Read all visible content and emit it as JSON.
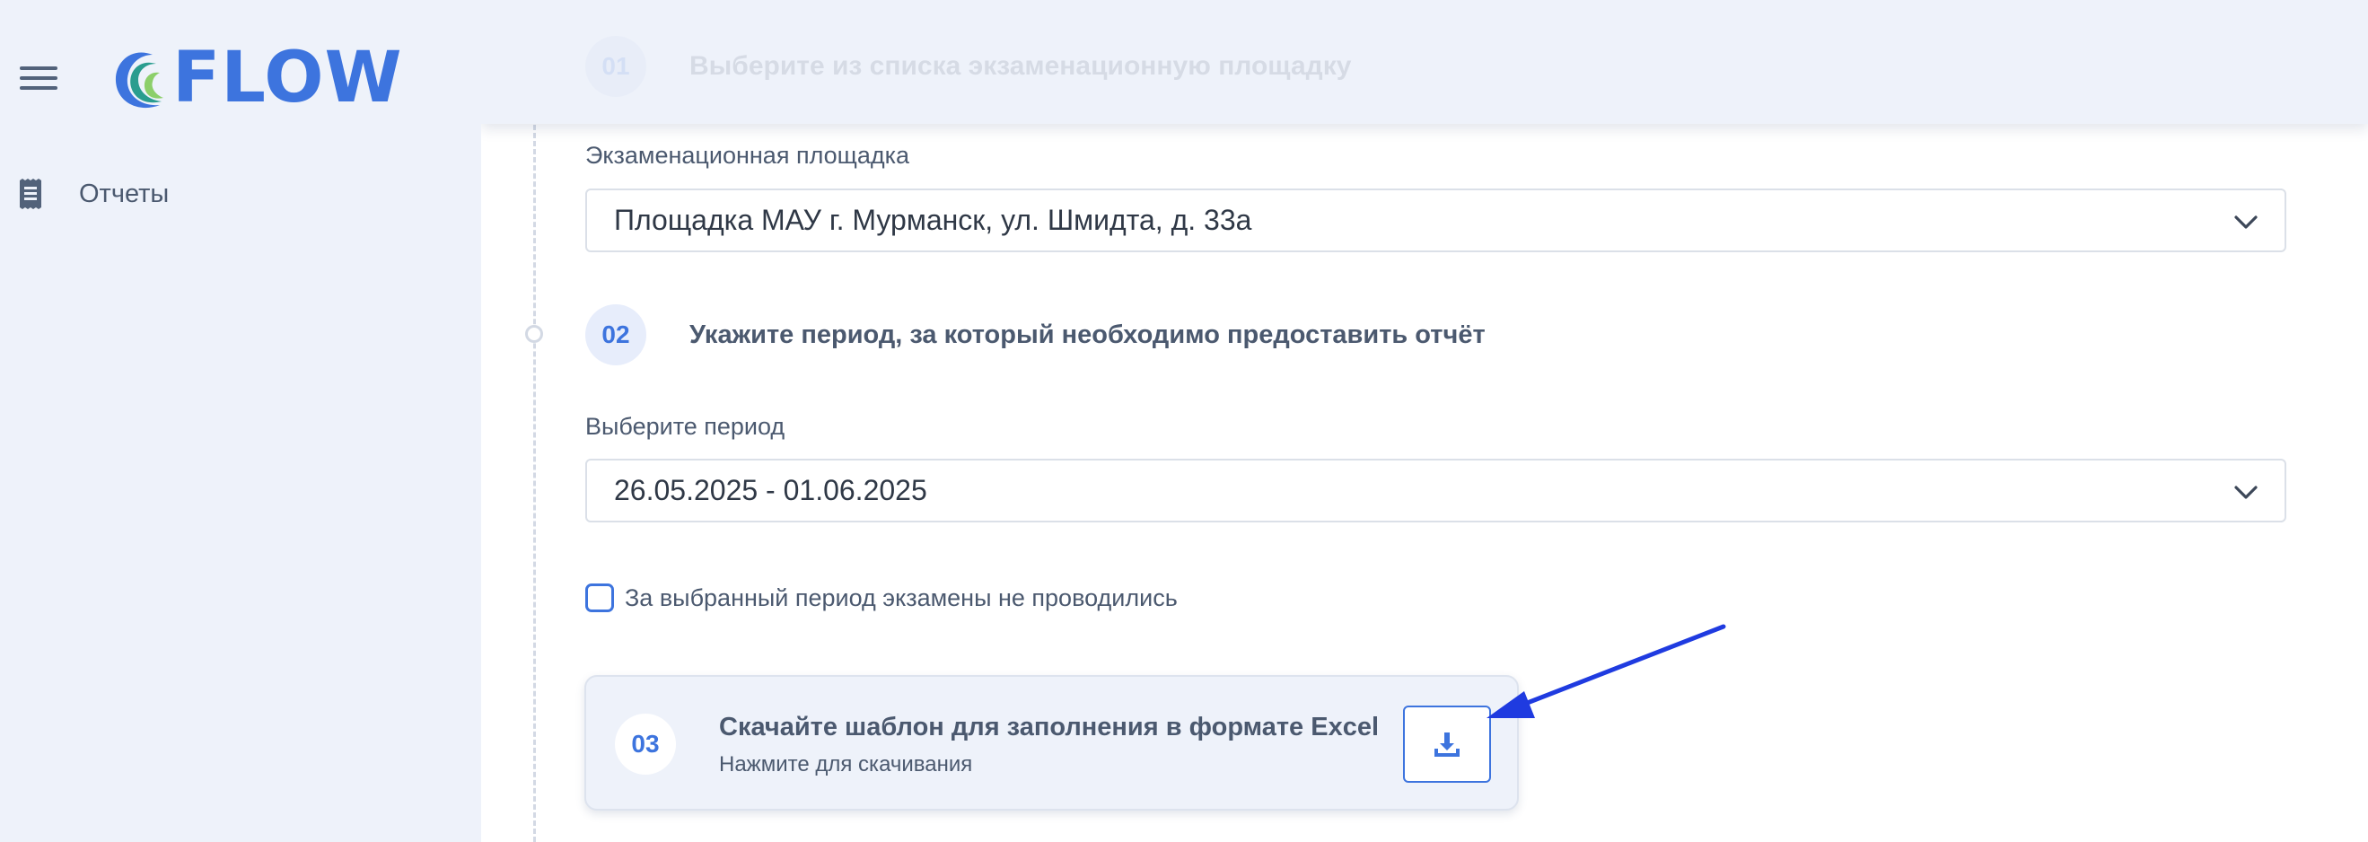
{
  "app": {
    "logo_text": "FLOW",
    "brand_color": "#3d74de"
  },
  "sidebar": {
    "items": [
      {
        "label": "Отчеты",
        "icon": "receipt-icon"
      }
    ]
  },
  "header": {
    "step01_number": "01",
    "step01_text": "Выберите из списка экзаменационную площадку"
  },
  "form": {
    "venue_label": "Экзаменационная площадка",
    "venue_value": "Площадка МАУ г. Мурманск, ул. Шмидта, д. 33а",
    "step02_number": "02",
    "step02_text": "Укажите период, за который необходимо предоставить отчёт",
    "period_label": "Выберите период",
    "period_value": "26.05.2025 - 01.06.2025",
    "no_exams_checkbox_label": "За выбранный период экзамены не проводились",
    "no_exams_checked": false
  },
  "download": {
    "step03_number": "03",
    "title": "Скачайте шаблон для заполнения в формате Excel",
    "subtitle": "Нажмите для скачивания",
    "icon": "download-icon"
  },
  "annotation": {
    "arrow_color": "#1f3be0"
  }
}
